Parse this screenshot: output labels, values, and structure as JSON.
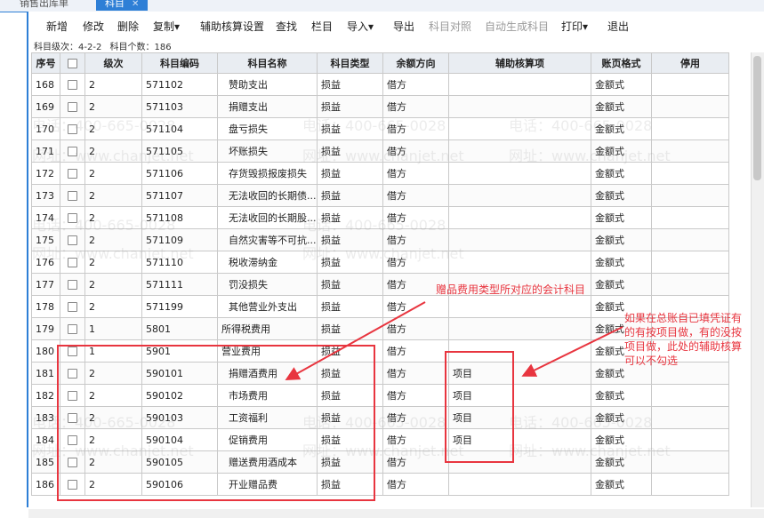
{
  "tabs": {
    "left_tab": "销售出库单",
    "active_tab": "科目",
    "close": "✕"
  },
  "toolbar": {
    "add": "新增",
    "edit": "修改",
    "delete": "删除",
    "copy": "复制",
    "aux": "辅助核算设置",
    "find": "查找",
    "column": "栏目",
    "import": "导入",
    "export": "导出",
    "match": "科目对照",
    "autogen": "自动生成科目",
    "print": "打印",
    "exit": "退出",
    "dropdown": "▾"
  },
  "meta": {
    "level": "科目级次：4-2-2",
    "count": "科目个数：186"
  },
  "table": {
    "headers": [
      "序号",
      "",
      "级次",
      "科目编码",
      "科目名称",
      "科目类型",
      "余额方向",
      "辅助核算项",
      "账页格式",
      "停用"
    ],
    "rows": [
      {
        "no": "168",
        "level": "2",
        "code": "571102",
        "name": "赞助支出",
        "type": "损益",
        "dir": "借方",
        "aux": "",
        "fmt": "金额式"
      },
      {
        "no": "169",
        "level": "2",
        "code": "571103",
        "name": "捐赠支出",
        "type": "损益",
        "dir": "借方",
        "aux": "",
        "fmt": "金额式"
      },
      {
        "no": "170",
        "level": "2",
        "code": "571104",
        "name": "盘亏损失",
        "type": "损益",
        "dir": "借方",
        "aux": "",
        "fmt": "金额式"
      },
      {
        "no": "171",
        "level": "2",
        "code": "571105",
        "name": "坏账损失",
        "type": "损益",
        "dir": "借方",
        "aux": "",
        "fmt": "金额式"
      },
      {
        "no": "172",
        "level": "2",
        "code": "571106",
        "name": "存货毁损报废损失",
        "type": "损益",
        "dir": "借方",
        "aux": "",
        "fmt": "金额式"
      },
      {
        "no": "173",
        "level": "2",
        "code": "571107",
        "name": "无法收回的长期债...",
        "type": "损益",
        "dir": "借方",
        "aux": "",
        "fmt": "金额式"
      },
      {
        "no": "174",
        "level": "2",
        "code": "571108",
        "name": "无法收回的长期股...",
        "type": "损益",
        "dir": "借方",
        "aux": "",
        "fmt": "金额式"
      },
      {
        "no": "175",
        "level": "2",
        "code": "571109",
        "name": "自然灾害等不可抗...",
        "type": "损益",
        "dir": "借方",
        "aux": "",
        "fmt": "金额式"
      },
      {
        "no": "176",
        "level": "2",
        "code": "571110",
        "name": "税收滞纳金",
        "type": "损益",
        "dir": "借方",
        "aux": "",
        "fmt": "金额式"
      },
      {
        "no": "177",
        "level": "2",
        "code": "571111",
        "name": "罚没损失",
        "type": "损益",
        "dir": "借方",
        "aux": "",
        "fmt": "金额式"
      },
      {
        "no": "178",
        "level": "2",
        "code": "571199",
        "name": "其他营业外支出",
        "type": "损益",
        "dir": "借方",
        "aux": "",
        "fmt": "金额式"
      },
      {
        "no": "179",
        "level": "1",
        "code": "5801",
        "name": "所得税费用",
        "type": "损益",
        "dir": "借方",
        "aux": "",
        "fmt": "金额式"
      },
      {
        "no": "180",
        "level": "1",
        "code": "5901",
        "name": "营业费用",
        "type": "损益",
        "dir": "借方",
        "aux": "",
        "fmt": "金额式"
      },
      {
        "no": "181",
        "level": "2",
        "code": "590101",
        "name": "捐赠酒费用",
        "type": "损益",
        "dir": "借方",
        "aux": "项目",
        "fmt": "金额式"
      },
      {
        "no": "182",
        "level": "2",
        "code": "590102",
        "name": "市场费用",
        "type": "损益",
        "dir": "借方",
        "aux": "项目",
        "fmt": "金额式"
      },
      {
        "no": "183",
        "level": "2",
        "code": "590103",
        "name": "工资福利",
        "type": "损益",
        "dir": "借方",
        "aux": "项目",
        "fmt": "金额式"
      },
      {
        "no": "184",
        "level": "2",
        "code": "590104",
        "name": "促销费用",
        "type": "损益",
        "dir": "借方",
        "aux": "项目",
        "fmt": "金额式"
      },
      {
        "no": "185",
        "level": "2",
        "code": "590105",
        "name": "赠送费用酒成本",
        "type": "损益",
        "dir": "借方",
        "aux": "",
        "fmt": "金额式"
      },
      {
        "no": "186",
        "level": "2",
        "code": "590106",
        "name": "开业赠品费",
        "type": "损益",
        "dir": "借方",
        "aux": "",
        "fmt": "金额式"
      }
    ]
  },
  "annotations": {
    "note1": "赠品费用类型所对应的会计科目",
    "note2_lines": [
      "如果在总账自已填凭证有",
      "的有按项目做，有的没按",
      "项目做，此处的辅助核算",
      "可以不勾选"
    ]
  },
  "watermark": {
    "phone": "电话：400-665-0028",
    "site": "网址：www.chanjet.net"
  },
  "colors": {
    "accent": "#2e7fd6",
    "annotation": "#e8353f"
  }
}
